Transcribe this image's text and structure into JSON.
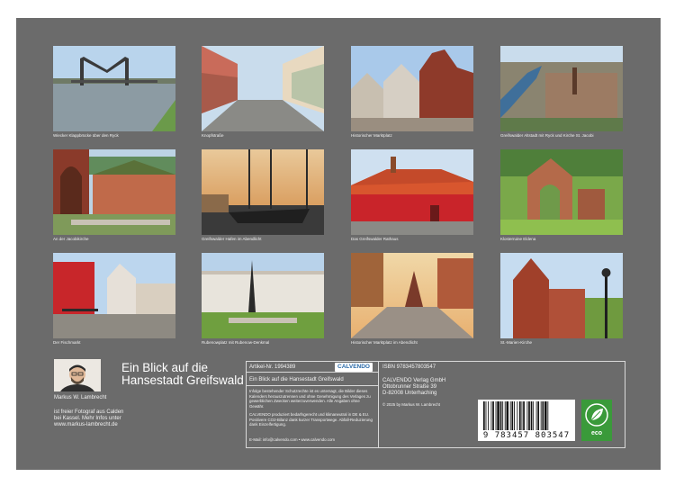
{
  "photos": [
    {
      "caption": "Wiecker Klappbrücke über den Ryck"
    },
    {
      "caption": "Knopfstraße"
    },
    {
      "caption": "Historischer Marktplatz"
    },
    {
      "caption": "Greifswalder Altstadt mit Ryck und Kirche St. Jacobi"
    },
    {
      "caption": "An der Jacobikirche"
    },
    {
      "caption": "Greifswalder Hafen im Abendlicht"
    },
    {
      "caption": "Das Greifswalder Rathaus"
    },
    {
      "caption": "Klosterruine Eldena"
    },
    {
      "caption": "Der Fischmarkt"
    },
    {
      "caption": "Rubenowplatz mit Rubenow-Denkmal"
    },
    {
      "caption": "Historischer Marktplatz im Abendlicht"
    },
    {
      "caption": "St.-Marien-Kirche"
    }
  ],
  "calendar": {
    "title": "Ein Blick auf die Hansestadt Greifswald",
    "author_name": "Markus W. Lambrecht",
    "author_bio": "ist freier Fotograf aus Calden bei Kassel. Mehr Infos unter www.markus-lambrecht.de"
  },
  "product": {
    "article_no": "Artikel-Nr. 1994389",
    "calvendo_logo": "CALVENDO",
    "title": "Ein Blick auf die Hansestadt Greifswald",
    "copyright_text": "Infolge bestehender Schutzrechte ist es untersagt, die Bilder dieses Kalenders herauszutrennen und ohne Genehmigung des Verlages zu gewerblichen Zwecken weiterzuverwenden. Alle Angaben ohne Gewähr.",
    "production_text": "CALVENDO produziert bedarfsgerecht und klimaneutral in DE & EU. Positivere CO2-Bilanz dank kurzer Transportwege. Abfall-Reduzierung dank Einzelfertigung.",
    "email": "E-Mail: info@calvendo.com • www.calvendo.com",
    "isbn": "ISBN 9783457803547",
    "publisher_name": "CALVENDO Verlag GmbH",
    "publisher_street": "Ottobrunner Straße 39",
    "publisher_city": "D-82008 Unterhaching",
    "publisher_copyright": "© 2025 by Markus W. Lambrecht",
    "barcode_digits": "9 783457 803547",
    "eco_label": "eco"
  },
  "colors": {
    "sheet_background": "#6b6b6b",
    "calvendo_blue": "#2a6aa8",
    "eco_green": "#3a9a3a"
  },
  "icons": {
    "eco_badge": "leaf-icon"
  }
}
